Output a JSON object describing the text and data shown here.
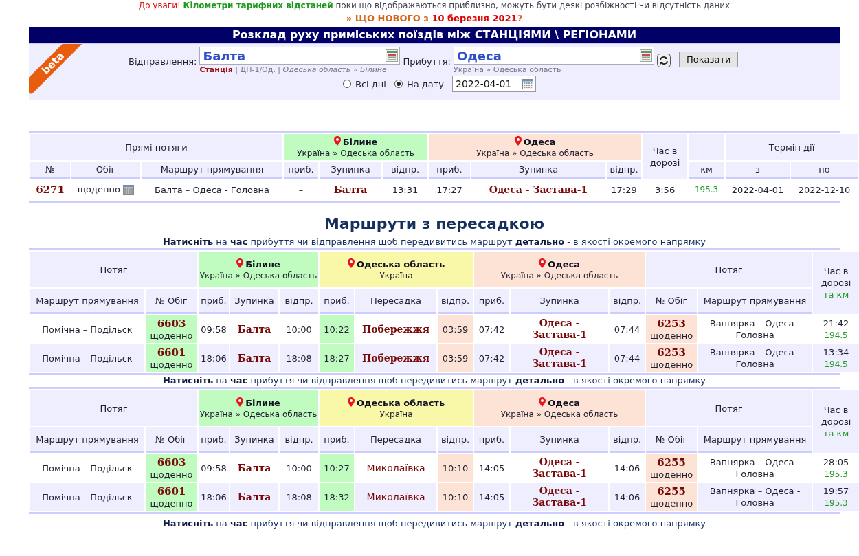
{
  "notice": [
    {
      "kind": "alert",
      "text": "До уваги!"
    },
    {
      "kind": "highlight",
      "text": "Кілометри тарифних відстаней"
    },
    {
      "kind": "plain",
      "text": "поки що відображаються приблизно, можуть бути деякі розбіжності  чи відсутність даних"
    }
  ],
  "whats_new": [
    {
      "kind": "plain",
      "text": "» ЩО НОВОГО з"
    },
    {
      "kind": "date",
      "text": "10 березня 2021"
    },
    {
      "kind": "plain",
      "text": "?"
    }
  ],
  "title": "Розклад руху приміських поїздів між СТАНЦІЯМИ \\ РЕГІОНАМИ",
  "beta": "beta",
  "form": {
    "departure": {
      "label": "Відправлення:",
      "value": "Балта",
      "hint": "**Станція** | ДН-1/Од. | *Одеська область » Білине*"
    },
    "arrival": {
      "label": "Прибуття:",
      "value": "Одеса",
      "hint": "Україна » Одеська область"
    },
    "show_button": "Показати",
    "modes": [
      {
        "label": "Всі дні",
        "selected": false
      },
      {
        "label": "На дату",
        "selected": true
      }
    ],
    "date": "2022-04-01"
  },
  "direct": {
    "title": "Прямі потяги",
    "stops": [
      {
        "name": "Білине",
        "sub": "Україна » Одеська область",
        "color": "#c0fcc0"
      },
      {
        "name": "Одеса",
        "sub": "Україна » Одеська область",
        "color": "#fde2d6"
      }
    ],
    "duration_header": "Час в дорозі",
    "validity_header": "Термін дії",
    "columns": [
      "№",
      "Обіг",
      "Маршрут прямування",
      "приб.",
      "Зупинка",
      "відпр.",
      "приб.",
      "Зупинка",
      "відпр.",
      "км",
      "з",
      "по"
    ],
    "rows": [
      {
        "number": "6271",
        "schedule": "щоденно",
        "route": "Балта – Одеса - Головна",
        "arr1": "–",
        "stop1": "Балта",
        "dep1": "13:31",
        "arr2": "17:27",
        "stop2": "Одеса - Застава-1",
        "dep2": "17:29",
        "duration": "3:56",
        "km": "195.3",
        "from": "2022-04-01",
        "to": "2022-12-10"
      }
    ]
  },
  "transfers": {
    "title": "Маршрути з пересадкою",
    "blocks": [
      {
        "hint": "**Натисніть** на **час** прибуття чи відправлення щоб передивитись маршрут **детально** - в якості окремого напрямку",
        "train_header": "Потяг",
        "train_header_2": "Потяг",
        "duration_header": "Час в дорозі",
        "km_header": "та км",
        "stops": [
          {
            "name": "Білине",
            "sub": "Україна » Одеська область",
            "color": "#c0fcc0"
          },
          {
            "name": "Одеська область",
            "sub": "Україна",
            "color": "#f8f8a8"
          },
          {
            "name": "Одеса",
            "sub": "Україна » Одеська область",
            "color": "#fde2d6"
          }
        ],
        "columns": [
          "Маршрут прямування",
          "№ Обіг",
          "приб.",
          "Зупинка",
          "відпр.",
          "приб.",
          "Пересадка",
          "відпр.",
          "приб.",
          "Зупинка",
          "відпр.",
          "№ Обіг",
          "Маршрут прямування"
        ],
        "rows": [
          {
            "route1": "Помічна – Подільск",
            "number1": "6603",
            "schedule1": "щоденно",
            "arr1": "09:58",
            "stop1": "Балта",
            "dep1": "10:00",
            "arr2": "10:22",
            "transfer": "Побережжя",
            "transfer_bold": true,
            "dep2": "03:59",
            "arr3": "07:42",
            "stop3": "Одеса - Застава-1",
            "dep3": "07:44",
            "number2": "6253",
            "schedule2": "щоденно",
            "route2": "Вапнярка – Одеса - Головна",
            "duration": "21:42",
            "km": "194.5"
          },
          {
            "route1": "Помічна – Подільск",
            "number1": "6601",
            "schedule1": "щоденно",
            "arr1": "18:06",
            "stop1": "Балта",
            "dep1": "18:08",
            "arr2": "18:27",
            "transfer": "Побережжя",
            "transfer_bold": true,
            "dep2": "03:59",
            "arr3": "07:42",
            "stop3": "Одеса - Застава-1",
            "dep3": "07:44",
            "number2": "6253",
            "schedule2": "щоденно",
            "route2": "Вапнярка – Одеса - Головна",
            "duration": "13:34",
            "km": "194.5"
          }
        ]
      },
      {
        "hint": "**Натисніть** на **час** прибуття чи відправлення щоб передивитись маршрут **детально** - в якості окремого напрямку",
        "train_header": "Потяг",
        "train_header_2": "Потяг",
        "duration_header": "Час в дорозі",
        "km_header": "та км",
        "stops": [
          {
            "name": "Білине",
            "sub": "Україна » Одеська область",
            "color": "#c0fcc0"
          },
          {
            "name": "Одеська область",
            "sub": "Україна",
            "color": "#f8f8a8"
          },
          {
            "name": "Одеса",
            "sub": "Україна » Одеська область",
            "color": "#fde2d6"
          }
        ],
        "columns": [
          "Маршрут прямування",
          "№ Обіг",
          "приб.",
          "Зупинка",
          "відпр.",
          "приб.",
          "Пересадка",
          "відпр.",
          "приб.",
          "Зупинка",
          "відпр.",
          "№ Обіг",
          "Маршрут прямування"
        ],
        "rows": [
          {
            "route1": "Помічна – Подільск",
            "number1": "6603",
            "schedule1": "щоденно",
            "arr1": "09:58",
            "stop1": "Балта",
            "dep1": "10:00",
            "arr2": "10:27",
            "transfer": "Миколаївка",
            "transfer_bold": false,
            "dep2": "10:10",
            "arr3": "14:05",
            "stop3": "Одеса - Застава-1",
            "dep3": "14:06",
            "number2": "6255",
            "schedule2": "щоденно",
            "route2": "Вапнярка – Одеса - Головна",
            "duration": "28:05",
            "km": "195.3"
          },
          {
            "route1": "Помічна – Подільск",
            "number1": "6601",
            "schedule1": "щоденно",
            "arr1": "18:06",
            "stop1": "Балта",
            "dep1": "18:08",
            "arr2": "18:32",
            "transfer": "Миколаївка",
            "transfer_bold": false,
            "dep2": "10:10",
            "arr3": "14:05",
            "stop3": "Одеса - Застава-1",
            "dep3": "14:06",
            "number2": "6255",
            "schedule2": "щоденно",
            "route2": "Вапнярка – Одеса - Головна",
            "duration": "19:57",
            "km": "195.3"
          }
        ]
      }
    ],
    "footer_hint": "**Натисніть** на **час** прибуття чи відправлення щоб передивитись маршрут **детально** - в якості окремого напрямку"
  }
}
